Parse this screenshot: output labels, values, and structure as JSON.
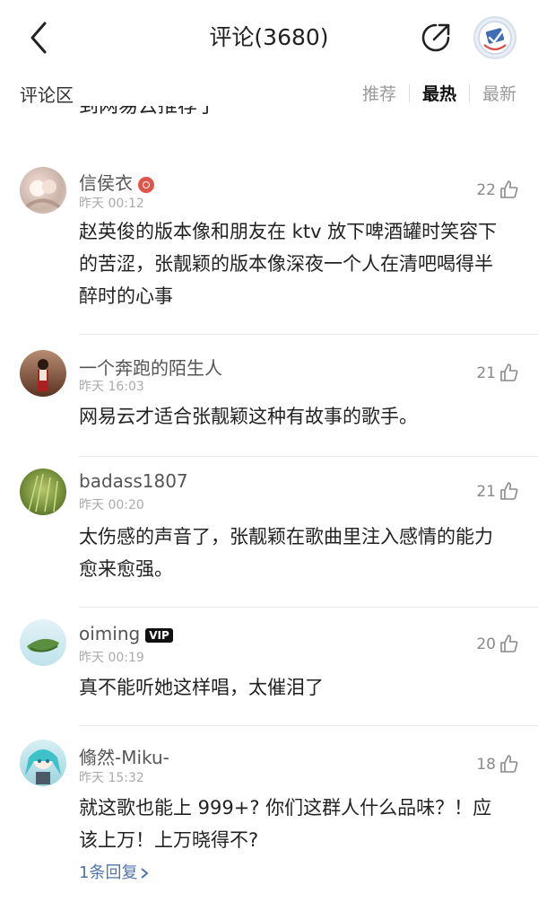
{
  "header": {
    "title": "评论(3680)"
  },
  "subbar": {
    "section_title": "评论区",
    "sorts": [
      "推荐",
      "最热",
      "最新"
    ]
  },
  "clipped_text": "到网易云推荐了",
  "comments": [
    {
      "name": "信侯衣",
      "time": "昨天 00:12",
      "likes": "22",
      "lines": [
        "赵英俊的版本像和朋友在 ktv 放下啤酒罐时笑容下",
        "的苦涩，张靓颖的版本像深夜一个人在清吧喝得半",
        "醉时的心事"
      ]
    },
    {
      "name": "一个奔跑的陌生人",
      "time": "昨天 16:03",
      "likes": "21",
      "lines": [
        "网易云才适合张靓颖这种有故事的歌手。"
      ]
    },
    {
      "name": "badass1807",
      "time": "昨天 00:20",
      "likes": "21",
      "lines": [
        "太伤感的声音了，张靓颖在歌曲里注入感情的能力",
        "愈来愈强。"
      ]
    },
    {
      "name": "oiming",
      "badge": "VIP",
      "time": "昨天 00:19",
      "likes": "20",
      "lines": [
        "真不能听她这样唱，太催泪了"
      ]
    },
    {
      "name": "翛然-Miku-",
      "time": "昨天 15:32",
      "likes": "18",
      "lines": [
        "就这歌也能上 999+? 你们这群人什么品味？！应",
        "该上万！上万晓得不?"
      ],
      "reply": "1条回复"
    }
  ]
}
